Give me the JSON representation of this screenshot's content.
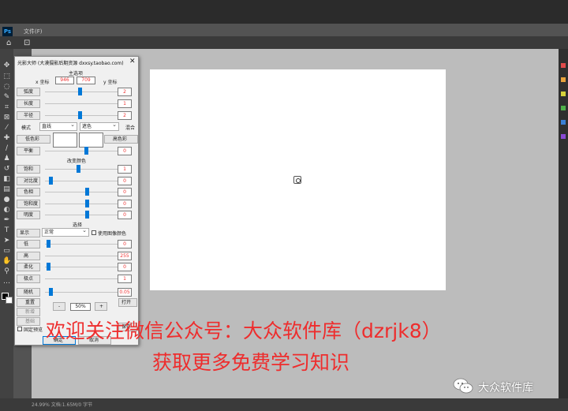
{
  "app": {
    "logo": "Ps",
    "menu_file": "文件(F)",
    "status": "24.99% 文档:1.65M/0 字节"
  },
  "dialog": {
    "title": "光影大师 (大漠摄影后期资源 dxxsy.taobao.com)",
    "close": "✕",
    "section_main": "主选项",
    "x_label": "x 坐标",
    "x_value": "946",
    "y_value": "709",
    "y_label": "y 坐标",
    "rows1": [
      {
        "label": "弧度",
        "value": "2",
        "pos": 0.42
      },
      {
        "label": "长度",
        "value": "1",
        "pos": 1.0
      },
      {
        "label": "半径",
        "value": "2",
        "pos": 0.42
      }
    ],
    "mode_label": "模式",
    "mode_value": "直线",
    "color_mode": "遮色",
    "blend_button": "混合",
    "low_color": "低色彩",
    "high_color": "高色彩",
    "balance": {
      "label": "平衡",
      "value": "0",
      "pos": 0.5
    },
    "section_color": "改变颜色",
    "rows2": [
      {
        "label": "饱和",
        "value": "1",
        "pos": 0.4
      },
      {
        "label": "对比度",
        "value": "0",
        "pos": 0.05
      },
      {
        "label": "色相",
        "value": "0",
        "pos": 0.52
      },
      {
        "label": "饱和度",
        "value": "0",
        "pos": 0.52
      },
      {
        "label": "明度",
        "value": "0",
        "pos": 0.52
      }
    ],
    "section_select": "选择",
    "display_label": "显示",
    "display_value": "正常",
    "use_image_color": "使用图像颜色",
    "rows3": [
      {
        "label": "低",
        "value": "0",
        "pos": 0.02
      },
      {
        "label": "高",
        "value": "255",
        "pos": 1.0
      },
      {
        "label": "柔化",
        "value": "0",
        "pos": 0.02
      },
      {
        "label": "极点",
        "value": "1",
        "pos": 1.0
      }
    ],
    "random": {
      "label": "随机",
      "value": "0.05",
      "pos": 0.05
    },
    "reset": "重置",
    "new": "新增",
    "base": "基础",
    "minus": "-",
    "zoom": "50%",
    "plus": "+",
    "open": "打开",
    "save": "保存",
    "fixed_preview": "固定预览",
    "ok": "确定",
    "cancel": "取消"
  },
  "overlay": {
    "line1": "欢迎关注微信公众号：大众软件库（dzrjk8）",
    "line2": "获取更多免费学习知识",
    "watermark": "大众软件库",
    "caption_color": "#ee2d2d"
  },
  "colors": {
    "accent": "#0078d7",
    "value_text": "#e33333",
    "pasteboard": "#bcbcbc"
  }
}
